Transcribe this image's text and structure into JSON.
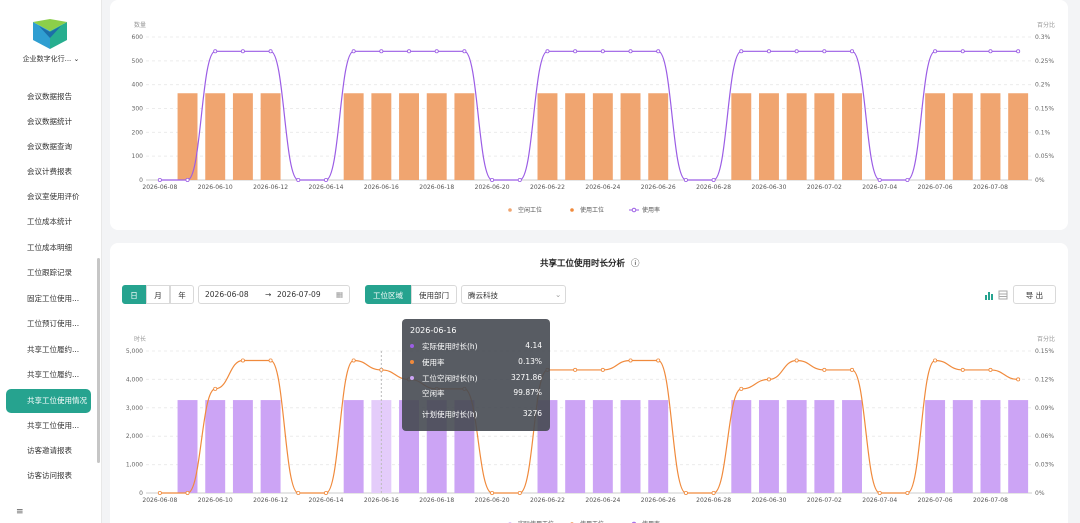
{
  "sidebar": {
    "org_name": "企业数字化行...",
    "collapse_icon": "≡",
    "items": [
      {
        "label": "会议数据报告"
      },
      {
        "label": "会议数据统计"
      },
      {
        "label": "会议数据查询"
      },
      {
        "label": "会议计费报表"
      },
      {
        "label": "会议室使用评价"
      },
      {
        "label": "工位成本统计"
      },
      {
        "label": "工位成本明细"
      },
      {
        "label": "工位跟踪记录"
      },
      {
        "label": "固定工位使用..."
      },
      {
        "label": "工位预订使用..."
      },
      {
        "label": "共享工位履约..."
      },
      {
        "label": "共享工位履约..."
      },
      {
        "label": "共享工位使用情况"
      },
      {
        "label": "共享工位使用..."
      },
      {
        "label": "访客邀请报表"
      },
      {
        "label": "访客访问报表"
      }
    ],
    "active_index": 12
  },
  "colors": {
    "accent": "#26a38f",
    "orange_bar": "#f0a570",
    "purple_line": "#9b5de5",
    "purple_bar": "#cca4f5",
    "orange_line": "#f08a3c"
  },
  "top_chart_panel": {
    "legend": [
      "空闲工位",
      "使用工位",
      "使用率"
    ]
  },
  "bottom_panel": {
    "title": "共享工位使用时长分析",
    "info_icon": "ⓘ",
    "period_buttons": [
      "日",
      "月",
      "年"
    ],
    "active_period": "日",
    "date_start": "2026-06-08",
    "date_sep": "→",
    "date_end": "2026-07-09",
    "calendar_icon": "▦",
    "scope_buttons": [
      "工位区域",
      "使用部门"
    ],
    "active_scope": "工位区域",
    "select_value": "腾云科技",
    "bar_chart_icon": "bar-chart-icon",
    "table_icon": "table-icon",
    "export_label": "导 出",
    "legend": [
      "实际使用工位",
      "使用工位",
      "使用率"
    ]
  },
  "tooltip": {
    "date": "2026-06-16",
    "rows": [
      {
        "label": "实际使用时长(h)",
        "value": "4.14",
        "color": "#9b5de5"
      },
      {
        "label": "使用率",
        "value": "0.13%",
        "color": "#f08a3c"
      },
      {
        "label": "工位空闲时长(h)",
        "value": "3271.86",
        "color": "#cca4f5"
      },
      {
        "label": "空闲率",
        "value": "99.87%",
        "color": ""
      },
      {
        "label": "计划使用时长(h)",
        "value": "3276",
        "color": ""
      }
    ]
  },
  "chart_data": [
    {
      "type": "bar",
      "ylabel": "数量",
      "y2label": "百分比",
      "ylim": [
        0,
        600
      ],
      "yticks": [
        "0",
        "100",
        "200",
        "300",
        "400",
        "500",
        "600"
      ],
      "y2ticks": [
        "0%",
        "0.05%",
        "0.1%",
        "0.15%",
        "0.2%",
        "0.25%",
        "0.3%"
      ],
      "x_tick_labels": [
        "2026-06-08",
        "2026-06-10",
        "2026-06-12",
        "2026-06-14",
        "2026-06-16",
        "2026-06-18",
        "2026-06-20",
        "2026-06-22",
        "2026-06-24",
        "2026-06-26",
        "2026-06-28",
        "2026-06-30",
        "2026-07-02",
        "2026-07-04",
        "2026-07-06",
        "2026-07-08"
      ],
      "categories": [
        "2026-06-08",
        "2026-06-09",
        "2026-06-10",
        "2026-06-11",
        "2026-06-12",
        "2026-06-13",
        "2026-06-14",
        "2026-06-15",
        "2026-06-16",
        "2026-06-17",
        "2026-06-18",
        "2026-06-19",
        "2026-06-20",
        "2026-06-21",
        "2026-06-22",
        "2026-06-23",
        "2026-06-24",
        "2026-06-25",
        "2026-06-26",
        "2026-06-27",
        "2026-06-28",
        "2026-06-29",
        "2026-06-30",
        "2026-07-01",
        "2026-07-02",
        "2026-07-03",
        "2026-07-04",
        "2026-07-05",
        "2026-07-06",
        "2026-07-07",
        "2026-07-08",
        "2026-07-09"
      ],
      "series": [
        {
          "name": "空闲工位",
          "values": [
            0,
            364,
            364,
            364,
            364,
            0,
            0,
            364,
            364,
            364,
            364,
            364,
            0,
            0,
            364,
            364,
            364,
            364,
            364,
            0,
            0,
            364,
            364,
            364,
            364,
            364,
            0,
            0,
            364,
            364,
            364,
            364
          ]
        },
        {
          "name": "使用工位",
          "values": [
            0,
            0,
            0,
            0,
            0,
            0,
            0,
            0,
            0,
            0,
            0,
            0,
            0,
            0,
            0,
            0,
            0,
            0,
            0,
            0,
            0,
            0,
            0,
            0,
            0,
            0,
            0,
            0,
            0,
            0,
            0,
            0
          ]
        },
        {
          "name": "使用率",
          "axis": "right",
          "values": [
            0,
            0,
            0.27,
            0.27,
            0.27,
            0,
            0,
            0.27,
            0.27,
            0.27,
            0.27,
            0.27,
            0,
            0,
            0.27,
            0.27,
            0.27,
            0.27,
            0.27,
            0,
            0,
            0.27,
            0.27,
            0.27,
            0.27,
            0.27,
            0,
            0,
            0.27,
            0.27,
            0.27,
            0.27
          ]
        }
      ],
      "y2lim": [
        0,
        0.3
      ]
    },
    {
      "type": "bar",
      "ylabel": "时长",
      "y2label": "百分比",
      "ylim": [
        0,
        5000
      ],
      "yticks": [
        "0",
        "1,000",
        "2,000",
        "3,000",
        "4,000",
        "5,000"
      ],
      "y2ticks": [
        "0%",
        "0.03%",
        "0.06%",
        "0.09%",
        "0.12%",
        "0.15%"
      ],
      "x_tick_labels": [
        "2026-06-08",
        "2026-06-10",
        "2026-06-12",
        "2026-06-14",
        "2026-06-16",
        "2026-06-18",
        "2026-06-20",
        "2026-06-22",
        "2026-06-24",
        "2026-06-26",
        "2026-06-28",
        "2026-06-30",
        "2026-07-02",
        "2026-07-04",
        "2026-07-06",
        "2026-07-08"
      ],
      "categories": [
        "2026-06-08",
        "2026-06-09",
        "2026-06-10",
        "2026-06-11",
        "2026-06-12",
        "2026-06-13",
        "2026-06-14",
        "2026-06-15",
        "2026-06-16",
        "2026-06-17",
        "2026-06-18",
        "2026-06-19",
        "2026-06-20",
        "2026-06-21",
        "2026-06-22",
        "2026-06-23",
        "2026-06-24",
        "2026-06-25",
        "2026-06-26",
        "2026-06-27",
        "2026-06-28",
        "2026-06-29",
        "2026-06-30",
        "2026-07-01",
        "2026-07-02",
        "2026-07-03",
        "2026-07-04",
        "2026-07-05",
        "2026-07-06",
        "2026-07-07",
        "2026-07-08",
        "2026-07-09"
      ],
      "series": [
        {
          "name": "工位空闲时长(h)",
          "values": [
            0,
            3272,
            3272,
            3272,
            3272,
            0,
            0,
            3272,
            3272,
            3272,
            3272,
            3272,
            0,
            0,
            3272,
            3272,
            3272,
            3272,
            3272,
            0,
            0,
            3272,
            3272,
            3272,
            3272,
            3272,
            0,
            0,
            3272,
            3272,
            3272,
            3272
          ]
        },
        {
          "name": "使用率",
          "axis": "right",
          "values": [
            0,
            0,
            0.11,
            0.14,
            0.14,
            0,
            0,
            0.14,
            0.13,
            0.12,
            0.11,
            0.11,
            0,
            0,
            0.13,
            0.13,
            0.13,
            0.14,
            0.14,
            0,
            0,
            0.11,
            0.12,
            0.14,
            0.13,
            0.13,
            0,
            0,
            0.14,
            0.13,
            0.13,
            0.12
          ]
        }
      ],
      "y2lim": [
        0,
        0.15
      ]
    }
  ]
}
